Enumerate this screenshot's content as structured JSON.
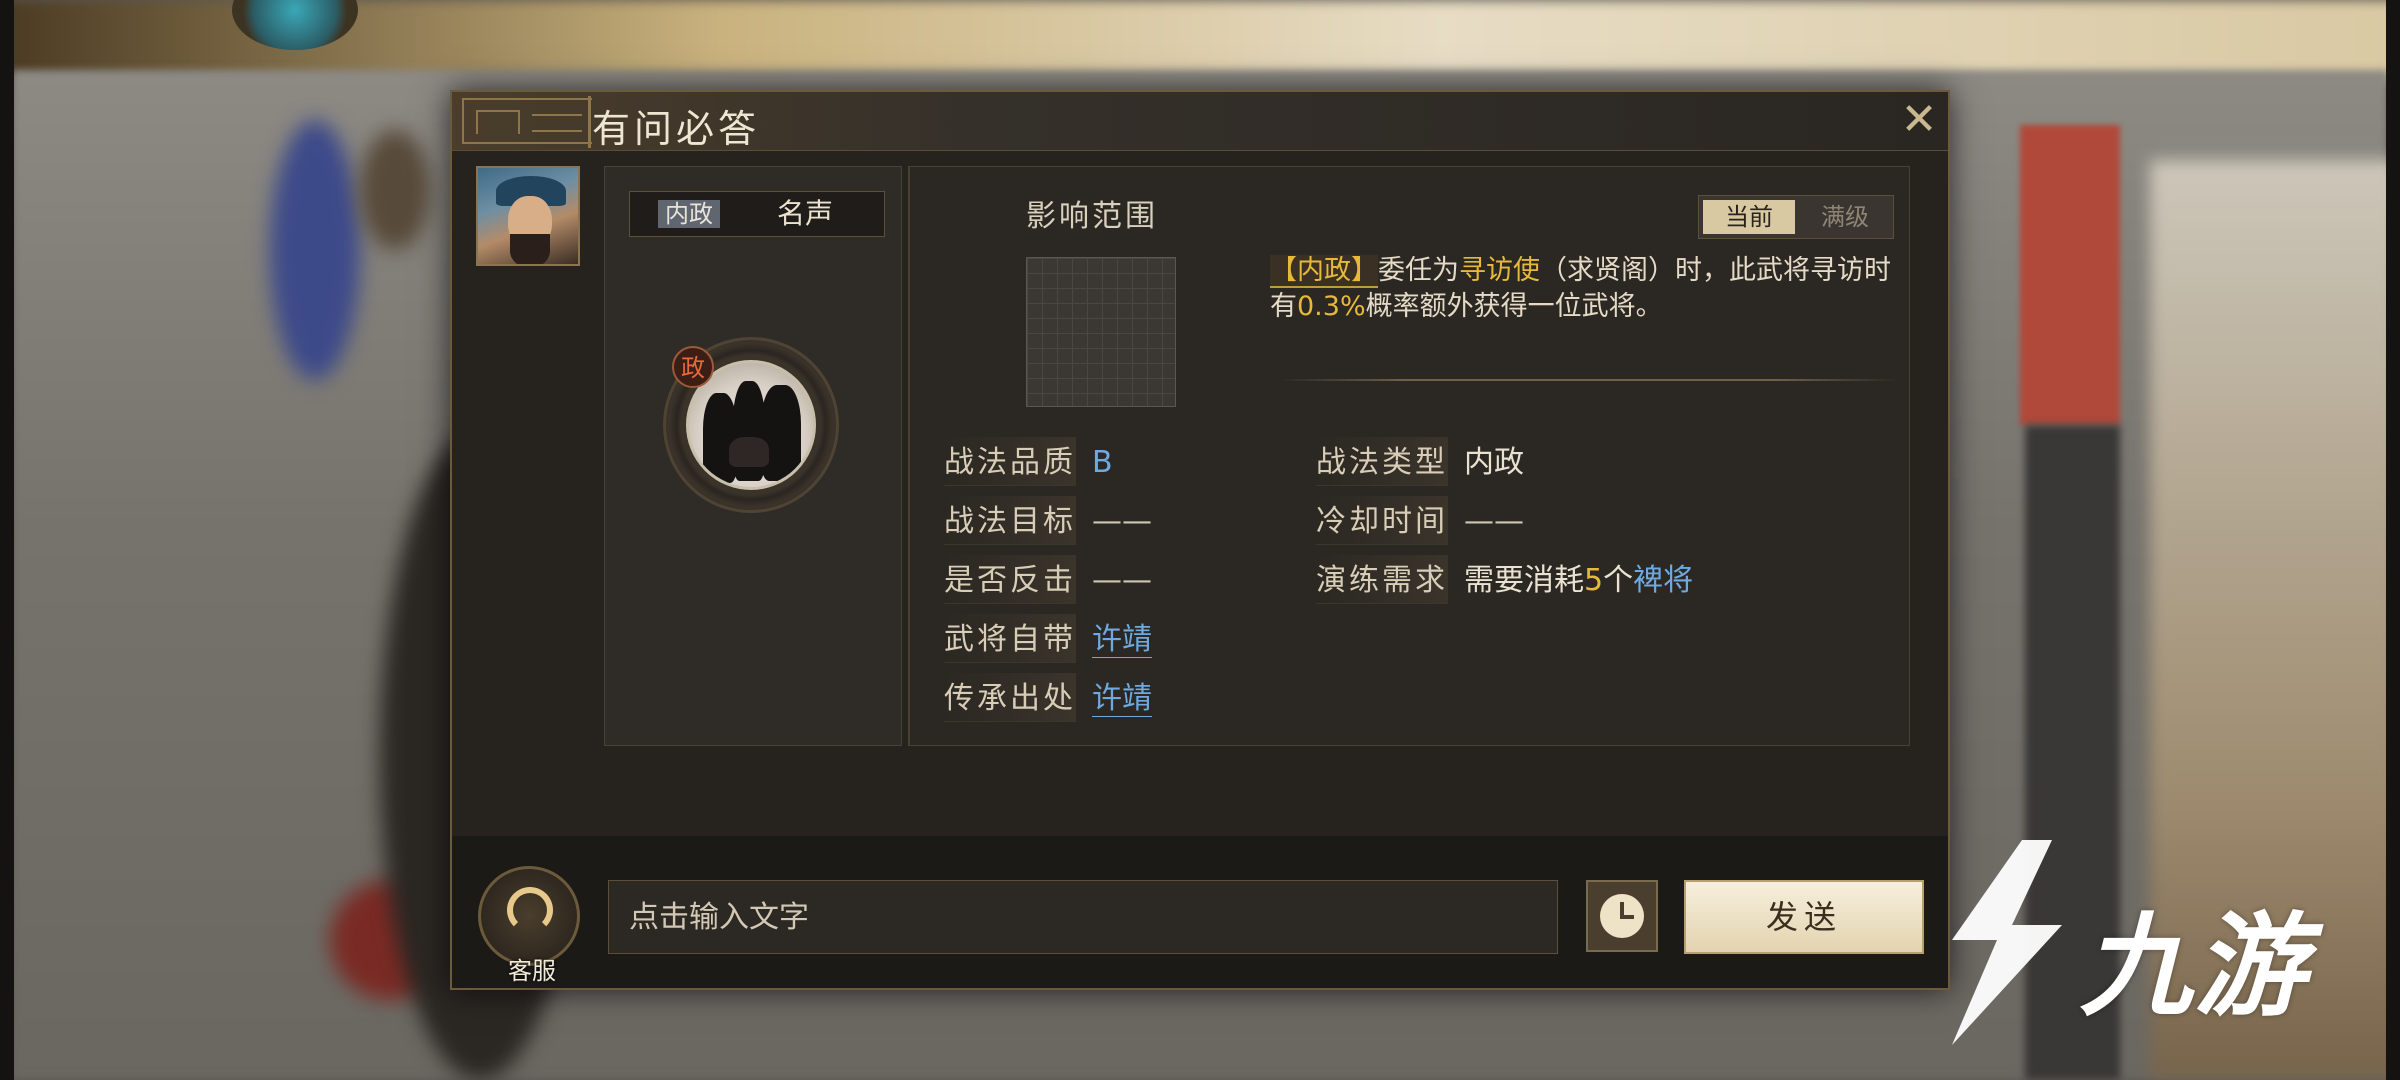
{
  "dialog": {
    "title": "有问必答",
    "close_icon": "close-icon"
  },
  "tabs": {
    "active": "内政",
    "other": "名声"
  },
  "skill": {
    "tag": "政",
    "range_label": "影响范围"
  },
  "level_toggle": {
    "current": "当前",
    "max": "满级"
  },
  "description": {
    "tag": "【内政】",
    "text1": "委任为",
    "role": "寻访使",
    "text2": "（求贤阁）时，此武将寻访时有",
    "prob": "0.3%",
    "text3": "概率额外获得一位武将。"
  },
  "attributes_left": [
    {
      "label": "战法品质",
      "value": "B"
    },
    {
      "label": "战法目标",
      "value": "——"
    },
    {
      "label": "是否反击",
      "value": "——"
    },
    {
      "label": "武将自带",
      "value": "许靖"
    },
    {
      "label": "传承出处",
      "value": "许靖"
    }
  ],
  "attributes_right": [
    {
      "label": "战法类型",
      "value": "内政"
    },
    {
      "label": "冷却时间",
      "value": "——"
    },
    {
      "label": "演练需求",
      "value_pre": "需要消耗",
      "value_num": "5",
      "value_mid": "个",
      "value_link": "裨将"
    }
  ],
  "bottom": {
    "customer_service": "客服",
    "input_placeholder": "点击输入文字",
    "send": "发送"
  },
  "watermark": {
    "text": "九游"
  },
  "colors": {
    "accent_gold": "#e6b93a",
    "link_blue": "#6ea9e0",
    "panel_dark": "#26231f"
  }
}
